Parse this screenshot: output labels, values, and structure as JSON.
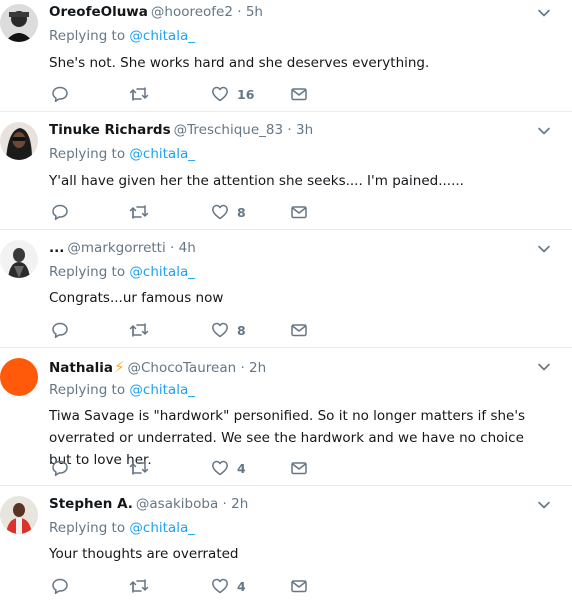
{
  "replying_label": "Replying to",
  "tweets": [
    {
      "name": "OreofeOluwa",
      "verified_emoji": "",
      "handle": "@hooreofe2",
      "dot": "·",
      "time": "5h",
      "reply_to": "@chitala_",
      "text": "She's not. She works hard and she deserves everything.",
      "likes": "16"
    },
    {
      "name": "Tinuke Richards",
      "verified_emoji": "",
      "handle": "@Treschique_83",
      "dot": "·",
      "time": "3h",
      "reply_to": "@chitala_",
      "text": "Y'all have given her the attention she seeks.... I'm pained......",
      "likes": "8"
    },
    {
      "name": "...",
      "verified_emoji": "",
      "handle": "@markgorretti",
      "dot": "·",
      "time": "4h",
      "reply_to": "@chitala_",
      "text": "Congrats...ur famous now",
      "likes": "8"
    },
    {
      "name": "Nathalia",
      "verified_emoji": "⚡",
      "handle": "@ChocoTaurean",
      "dot": "·",
      "time": "2h",
      "reply_to": "@chitala_",
      "text": "Tiwa Savage is \"hardwork\" personified. So it no longer matters if she's overrated or underrated. We see the hardwork and we have no choice but to love her.",
      "likes": "4"
    },
    {
      "name": "Stephen A.",
      "verified_emoji": "",
      "handle": "@asakiboba",
      "dot": "·",
      "time": "2h",
      "reply_to": "@chitala_",
      "text": "Your thoughts are overrated",
      "likes": "4"
    }
  ],
  "colors": {
    "mention": "#1da1f2",
    "muted": "#657786",
    "divider": "#e6ecf0",
    "bolt": "#ffad1f"
  },
  "icons": [
    "reply-icon",
    "retweet-icon",
    "like-icon",
    "message-icon",
    "chevron-down-icon"
  ]
}
